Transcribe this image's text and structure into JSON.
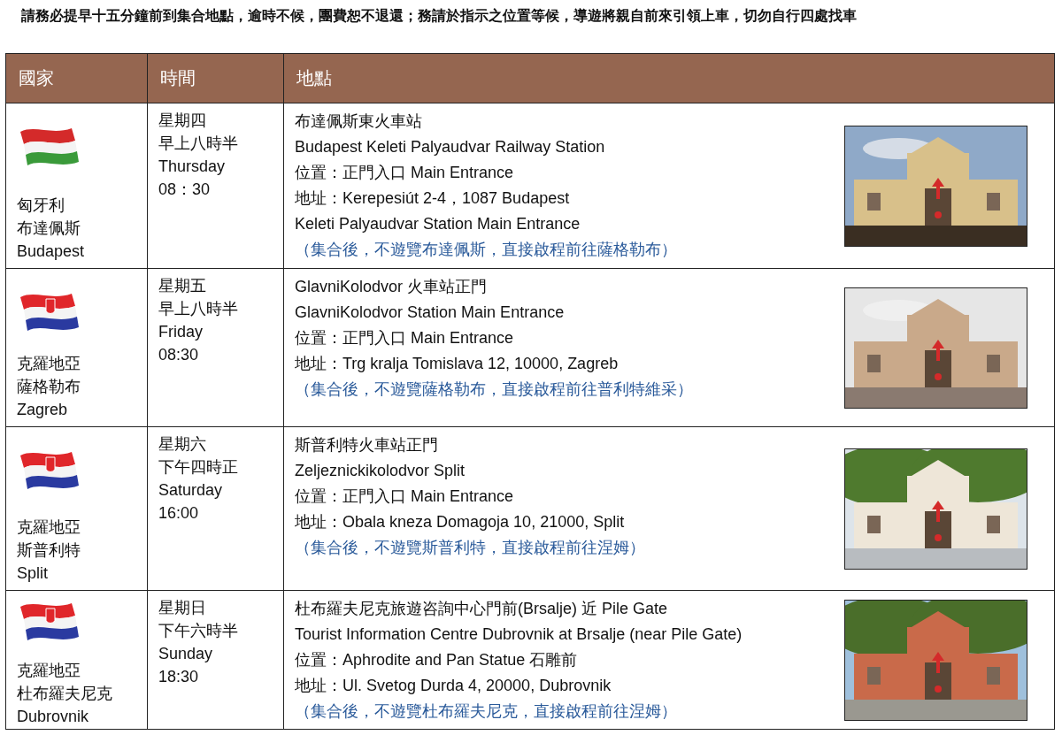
{
  "notice": "請務必提早十五分鐘前到集合地點，逾時不候，團費恕不退還；務請於指示之位置等候，導遊將親自前來引領上車，切勿自行四處找車",
  "table": {
    "columns": [
      "國家",
      "時間",
      "地點"
    ],
    "rows": [
      {
        "flag": {
          "kind": "hungary"
        },
        "country": [
          "匈牙利",
          "布達佩斯",
          "Budapest"
        ],
        "time": [
          "星期四",
          "早上八時半",
          "Thursday",
          "08：30"
        ],
        "place": [
          {
            "kind": "line",
            "text": "布達佩斯東火車站"
          },
          {
            "kind": "line",
            "text": "Budapest Keleti Palyaudvar Railway Station"
          },
          {
            "kind": "line",
            "text": "位置：正門入口 Main Entrance"
          },
          {
            "kind": "line",
            "text": "地址：Kerepesiút 2-4，1087 Budapest"
          },
          {
            "kind": "line",
            "text": "Keleti Palyaudvar Station Main Entrance"
          },
          {
            "kind": "note",
            "text": "（集合後，不遊覽布達佩斯，直接啟程前往薩格勒布）"
          }
        ],
        "photo": {
          "kind": "picture"
        }
      },
      {
        "flag": {
          "kind": "croatia"
        },
        "country": [
          "克羅地亞",
          "薩格勒布",
          "Zagreb"
        ],
        "time": [
          "星期五",
          "早上八時半",
          "Friday",
          "08:30"
        ],
        "place": [
          {
            "kind": "line",
            "text": "GlavniKolodvor 火車站正門"
          },
          {
            "kind": "line",
            "text": "GlavniKolodvor Station Main Entrance"
          },
          {
            "kind": "line",
            "text": "位置：正門入口 Main Entrance"
          },
          {
            "kind": "line",
            "text": "地址：Trg kralja Tomislava 12, 10000, Zagreb"
          },
          {
            "kind": "note",
            "text": "（集合後，不遊覽薩格勒布，直接啟程前往普利特維采）"
          }
        ],
        "photo": {
          "kind": "picture"
        }
      },
      {
        "flag": {
          "kind": "croatia"
        },
        "country": [
          "克羅地亞",
          "斯普利特",
          "Split"
        ],
        "time": [
          "星期六",
          "下午四時正",
          "Saturday",
          "16:00"
        ],
        "place": [
          {
            "kind": "line",
            "text": "斯普利特火車站正門"
          },
          {
            "kind": "line",
            "text": "Zeljeznickikolodvor Split"
          },
          {
            "kind": "line",
            "text": "位置：正門入口 Main Entrance"
          },
          {
            "kind": "line",
            "text": "地址：Obala kneza Domagoja 10, 21000, Split"
          },
          {
            "kind": "note",
            "text": "（集合後，不遊覽斯普利特，直接啟程前往涅姆）"
          }
        ],
        "photo": {
          "kind": "picture"
        }
      },
      {
        "flag": {
          "kind": "croatia"
        },
        "country": [
          "克羅地亞",
          "杜布羅夫尼克",
          "Dubrovnik"
        ],
        "time": [
          "星期日",
          "下午六時半",
          "Sunday",
          "18:30"
        ],
        "place": [
          {
            "kind": "line",
            "text": "杜布羅夫尼克旅遊咨詢中心門前(Brsalje)  近 Pile Gate"
          },
          {
            "kind": "line",
            "text": "Tourist Information Centre Dubrovnik at Brsalje (near Pile Gate)"
          },
          {
            "kind": "line",
            "text": "位置：Aphrodite and Pan Statue  石雕前"
          },
          {
            "kind": "line",
            "text": "地址：Ul. Svetog Durda 4, 20000, Dubrovnik"
          },
          {
            "kind": "note",
            "text": "（集合後，不遊覽杜布羅夫尼克，直接啟程前往涅姆）"
          }
        ],
        "photo": {
          "kind": "picture"
        }
      }
    ]
  }
}
